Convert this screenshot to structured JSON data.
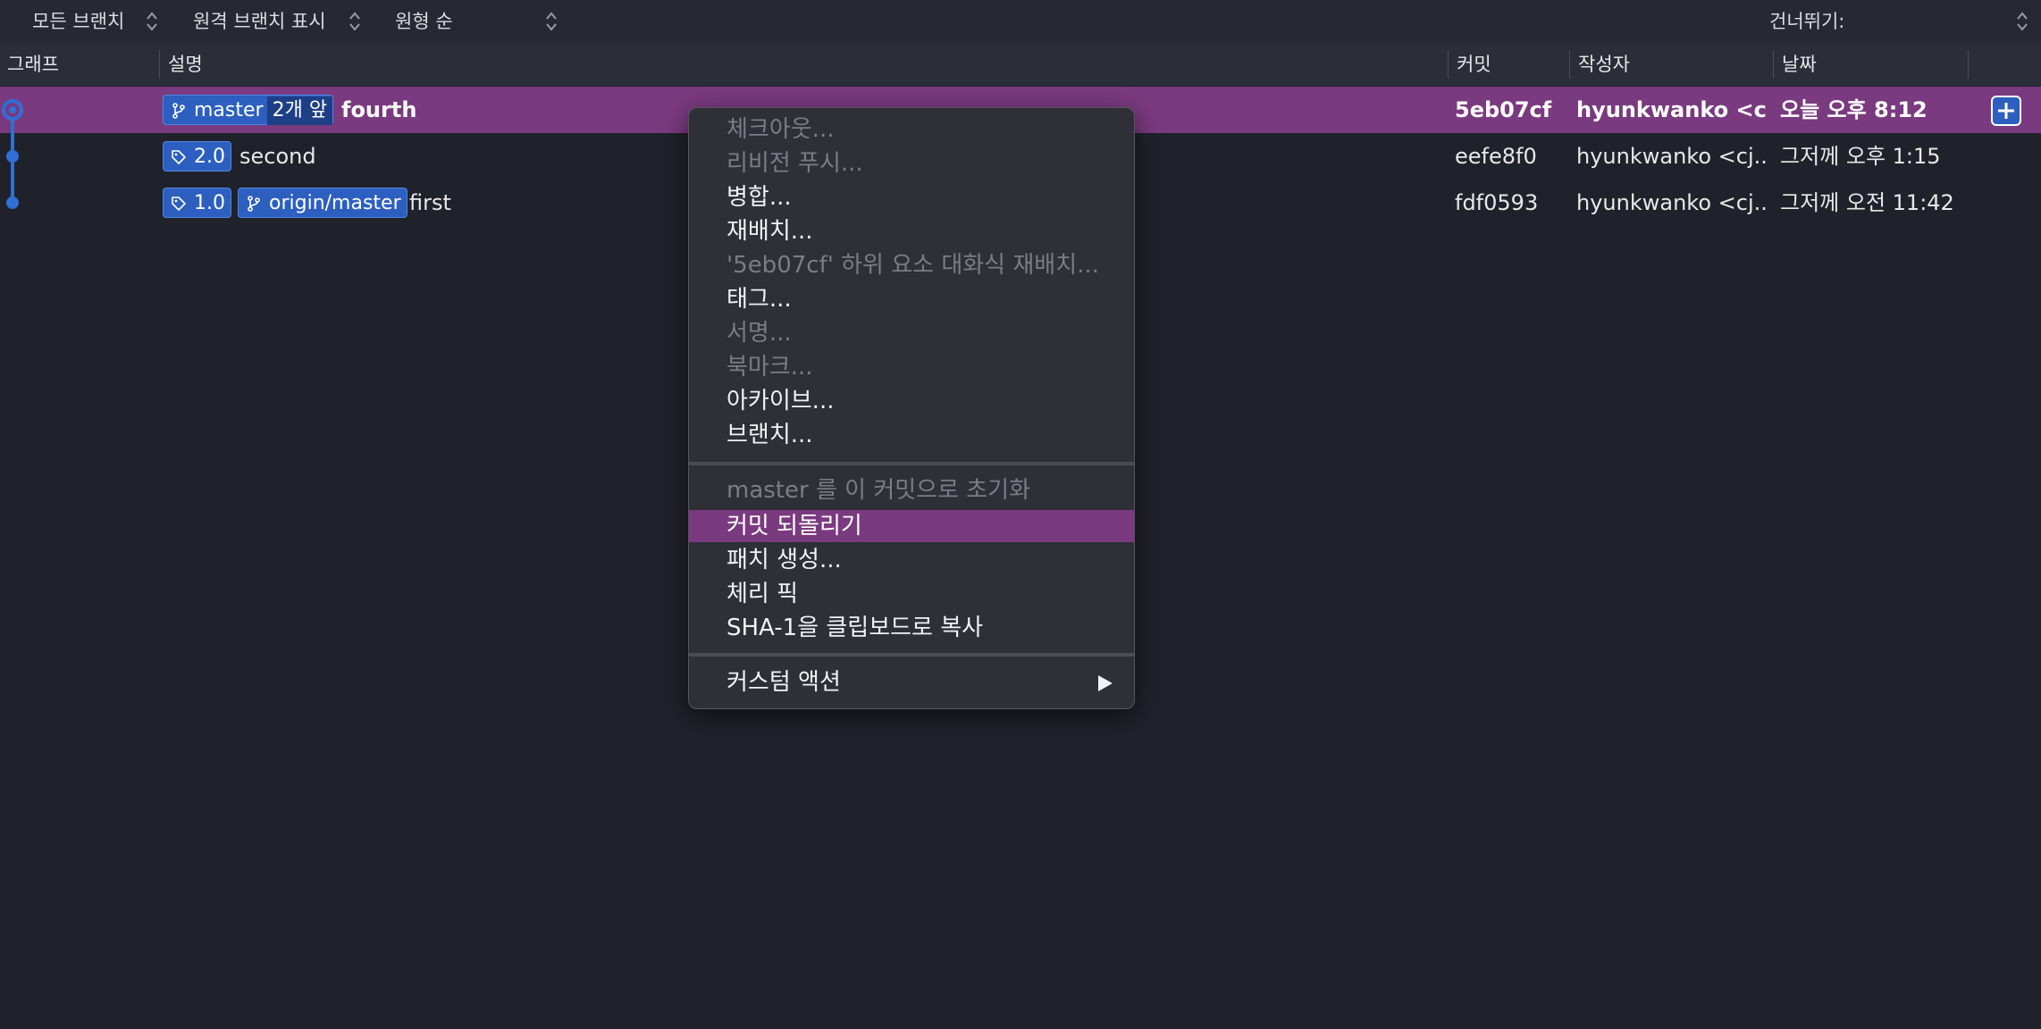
{
  "toolbar": {
    "branch_filter": "모든 브랜치",
    "remote_filter": "원격 브랜치 표시",
    "order_filter": "원형 순",
    "jump_to_label": "건너뛰기:"
  },
  "columns": {
    "graph": "그래프",
    "description": "설명",
    "commit": "커밋",
    "author": "작성자",
    "date": "날짜"
  },
  "commits": [
    {
      "badges": [
        {
          "type": "branch",
          "label": "master",
          "ahead": "2개 앞"
        }
      ],
      "subject": "fourth",
      "hash": "5eb07cf",
      "author": "hyunkwanko <c...",
      "date": "오늘 오후 8:12",
      "selected": true
    },
    {
      "badges": [
        {
          "type": "tag",
          "label": "2.0"
        }
      ],
      "subject": "second",
      "hash": "eefe8f0",
      "author": "hyunkwanko <cj...",
      "date": "그저께 오후 1:15",
      "selected": false
    },
    {
      "badges": [
        {
          "type": "tag",
          "label": "1.0"
        },
        {
          "type": "branch",
          "label": "origin/master"
        }
      ],
      "subject": "first",
      "hash": "fdf0593",
      "author": "hyunkwanko <cj...",
      "date": "그저께 오전 11:42",
      "selected": false
    }
  ],
  "context_menu": {
    "items": [
      {
        "label": "체크아웃...",
        "enabled": false
      },
      {
        "label": "리비전 푸시...",
        "enabled": false
      },
      {
        "label": "병합...",
        "enabled": true
      },
      {
        "label": "재배치...",
        "enabled": true
      },
      {
        "label": "'5eb07cf' 하위 요소 대화식 재배치...",
        "enabled": false
      },
      {
        "label": "태그...",
        "enabled": true
      },
      {
        "label": "서명...",
        "enabled": false
      },
      {
        "label": "북마크...",
        "enabled": false
      },
      {
        "label": "아카이브...",
        "enabled": true
      },
      {
        "label": "브랜치...",
        "enabled": true
      },
      {
        "label": "master 를 이 커밋으로 초기화",
        "enabled": false
      },
      {
        "label": "커밋 되돌리기",
        "enabled": true,
        "highlighted": true
      },
      {
        "label": "패치 생성...",
        "enabled": true
      },
      {
        "label": "체리 픽",
        "enabled": true
      },
      {
        "label": "SHA-1을 클립보드로 복사",
        "enabled": true
      },
      {
        "label": "커스텀 액션",
        "enabled": true,
        "submenu": true
      }
    ]
  },
  "colors": {
    "selection": "#7a3a7f",
    "badge": "#2c5fc0",
    "graph_line": "#2f6fd6"
  },
  "icons": {
    "branch": "branch-icon",
    "tag": "tag-icon",
    "add": "plus-icon",
    "stepper": "updown-chevron-icon",
    "submenu": "submenu-arrow-icon"
  }
}
